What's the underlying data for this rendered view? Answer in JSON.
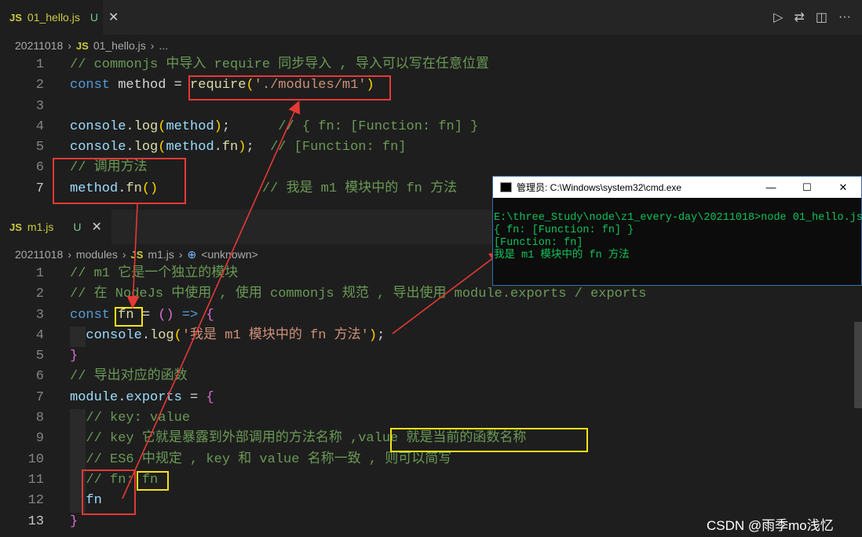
{
  "top_editor": {
    "tab": {
      "lang": "JS",
      "name": "01_hello.js",
      "status": "U"
    },
    "breadcrumb": [
      "20211018",
      "JS",
      "01_hello.js",
      "..."
    ],
    "lines": [
      {
        "n": "1",
        "segs": [
          [
            "c",
            "// commonjs 中导入 require 同步导入 , 导入可以写在任意位置"
          ]
        ]
      },
      {
        "n": "2",
        "segs": [
          [
            "k",
            "const"
          ],
          [
            "p",
            " method = "
          ],
          [
            "f",
            "require"
          ],
          [
            "b",
            "("
          ],
          [
            "s",
            "'./modules/m1'"
          ],
          [
            "b",
            ")"
          ]
        ]
      },
      {
        "n": "3",
        "segs": []
      },
      {
        "n": "4",
        "segs": [
          [
            "v",
            "console"
          ],
          [
            "p",
            "."
          ],
          [
            "f",
            "log"
          ],
          [
            "b",
            "("
          ],
          [
            "v",
            "method"
          ],
          [
            "b",
            ")"
          ],
          [
            "p",
            ";      "
          ],
          [
            "c",
            "// { fn: [Function: fn] }"
          ]
        ]
      },
      {
        "n": "5",
        "segs": [
          [
            "v",
            "console"
          ],
          [
            "p",
            "."
          ],
          [
            "f",
            "log"
          ],
          [
            "b",
            "("
          ],
          [
            "v",
            "method"
          ],
          [
            "p",
            "."
          ],
          [
            "f",
            "fn"
          ],
          [
            "b",
            ")"
          ],
          [
            "p",
            ";  "
          ],
          [
            "c",
            "// [Function: fn]"
          ]
        ]
      },
      {
        "n": "6",
        "segs": [
          [
            "c",
            "// 调用方法"
          ]
        ]
      },
      {
        "n": "7",
        "segs": [
          [
            "v",
            "method"
          ],
          [
            "p",
            "."
          ],
          [
            "f",
            "fn"
          ],
          [
            "b",
            "()"
          ],
          [
            "p",
            "             "
          ],
          [
            "c",
            "// 我是 m1 模块中的 fn 方法"
          ]
        ]
      }
    ]
  },
  "bottom_editor": {
    "tab": {
      "lang": "JS",
      "name": "m1.js",
      "status": "U"
    },
    "breadcrumb": [
      "20211018",
      "modules",
      "JS",
      "m1.js",
      "<unknown>"
    ],
    "lines": [
      {
        "n": "1",
        "segs": [
          [
            "c",
            "// m1 它是一个独立的模块"
          ]
        ]
      },
      {
        "n": "2",
        "segs": [
          [
            "c",
            "// 在 NodeJs 中使用 , 使用 commonjs 规范 , 导出使用 module.exports / exports"
          ]
        ]
      },
      {
        "n": "3",
        "segs": [
          [
            "k",
            "const"
          ],
          [
            "p",
            " "
          ],
          [
            "f",
            "fn"
          ],
          [
            "p",
            " = "
          ],
          [
            "b2",
            "()"
          ],
          [
            "p",
            " "
          ],
          [
            "k",
            "=>"
          ],
          [
            "p",
            " "
          ],
          [
            "b2",
            "{"
          ]
        ]
      },
      {
        "n": "4",
        "segs": [
          [
            "p",
            "  "
          ],
          [
            "v",
            "console"
          ],
          [
            "p",
            "."
          ],
          [
            "f",
            "log"
          ],
          [
            "b",
            "("
          ],
          [
            "s",
            "'我是 m1 模块中的 fn 方法'"
          ],
          [
            "b",
            ")"
          ],
          [
            "p",
            ";"
          ]
        ]
      },
      {
        "n": "5",
        "segs": [
          [
            "b2",
            "}"
          ]
        ]
      },
      {
        "n": "6",
        "segs": [
          [
            "c",
            "// 导出对应的函数"
          ]
        ]
      },
      {
        "n": "7",
        "segs": [
          [
            "v",
            "module"
          ],
          [
            "p",
            "."
          ],
          [
            "v",
            "exports"
          ],
          [
            "p",
            " = "
          ],
          [
            "b2",
            "{"
          ]
        ]
      },
      {
        "n": "8",
        "segs": [
          [
            "p",
            "  "
          ],
          [
            "c",
            "// key: value"
          ]
        ]
      },
      {
        "n": "9",
        "segs": [
          [
            "p",
            "  "
          ],
          [
            "c",
            "// key 它就是暴露到外部调用的方法名称 ,value 就是当前的函数名称"
          ]
        ]
      },
      {
        "n": "10",
        "segs": [
          [
            "p",
            "  "
          ],
          [
            "c",
            "// ES6 中规定 , key 和 value 名称一致 , 则可以简写"
          ]
        ]
      },
      {
        "n": "11",
        "segs": [
          [
            "p",
            "  "
          ],
          [
            "c",
            "// fn: fn"
          ]
        ]
      },
      {
        "n": "12",
        "segs": [
          [
            "p",
            "  "
          ],
          [
            "v",
            "fn"
          ]
        ]
      },
      {
        "n": "13",
        "segs": [
          [
            "b2",
            "}"
          ]
        ]
      }
    ]
  },
  "cmd_window": {
    "title": "管理员: C:\\Windows\\system32\\cmd.exe",
    "controls": [
      "—",
      "☐",
      "✕"
    ],
    "output": "E:\\three_Study\\node\\z1_every-day\\20211018>node 01_hello.js\n{ fn: [Function: fn] }\n[Function: fn]\n我是 m1 模块中的 fn 方法"
  },
  "watermark": "CSDN @雨季mo浅忆",
  "colors": {
    "annotation_red": "#e53935",
    "annotation_yellow": "#f5e317",
    "console_green": "#13c15a"
  }
}
